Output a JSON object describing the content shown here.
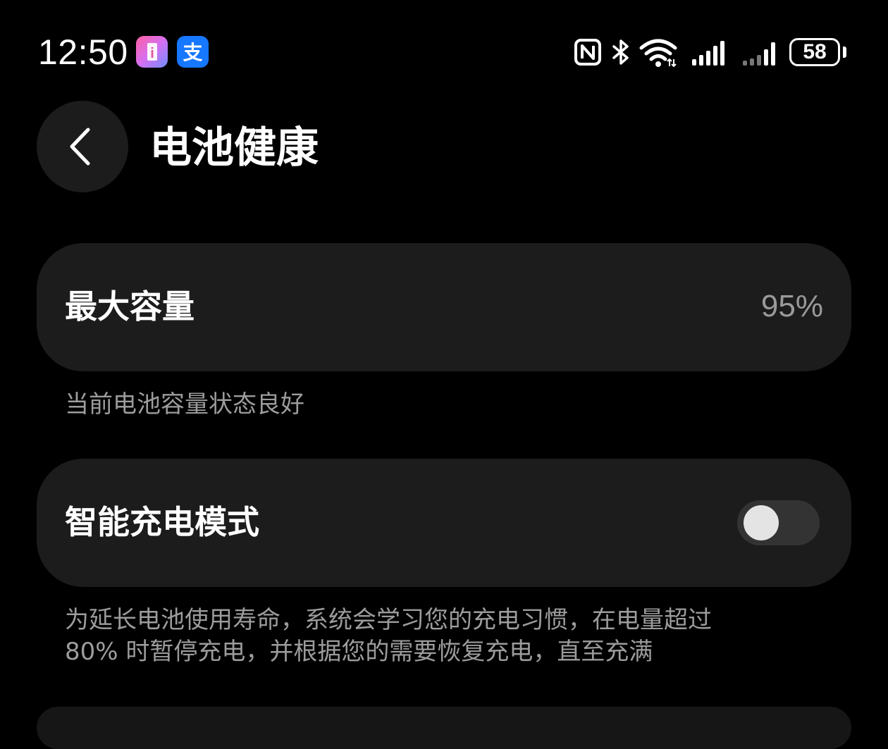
{
  "status_bar": {
    "time": "12:50",
    "notification_icons": [
      "reader-app-icon",
      "alipay-app-icon"
    ],
    "alipay_glyph": "支",
    "reader_glyph": "i",
    "system_icons": [
      "nfc-icon",
      "bluetooth-icon",
      "wifi-icon",
      "cell-signal-icon",
      "cell-signal-icon-2"
    ],
    "battery_level": "58"
  },
  "header": {
    "back_icon": "chevron-left-icon",
    "title": "电池健康"
  },
  "capacity": {
    "label": "最大容量",
    "value": "95%",
    "caption": "当前电池容量状态良好"
  },
  "smart_charging": {
    "label": "智能充电模式",
    "enabled": false,
    "caption_line1": "为延长电池使用寿命，系统会学习您的充电习惯，在电量超过",
    "caption_line2": "80% 时暂停充电，并根据您的需要恢复充电，直至充满"
  },
  "colors": {
    "background": "#000000",
    "card": "#1c1c1c",
    "secondary_text": "#9c9c9c",
    "toggle_track_off": "#333333",
    "alipay_brand": "#1677ff"
  }
}
